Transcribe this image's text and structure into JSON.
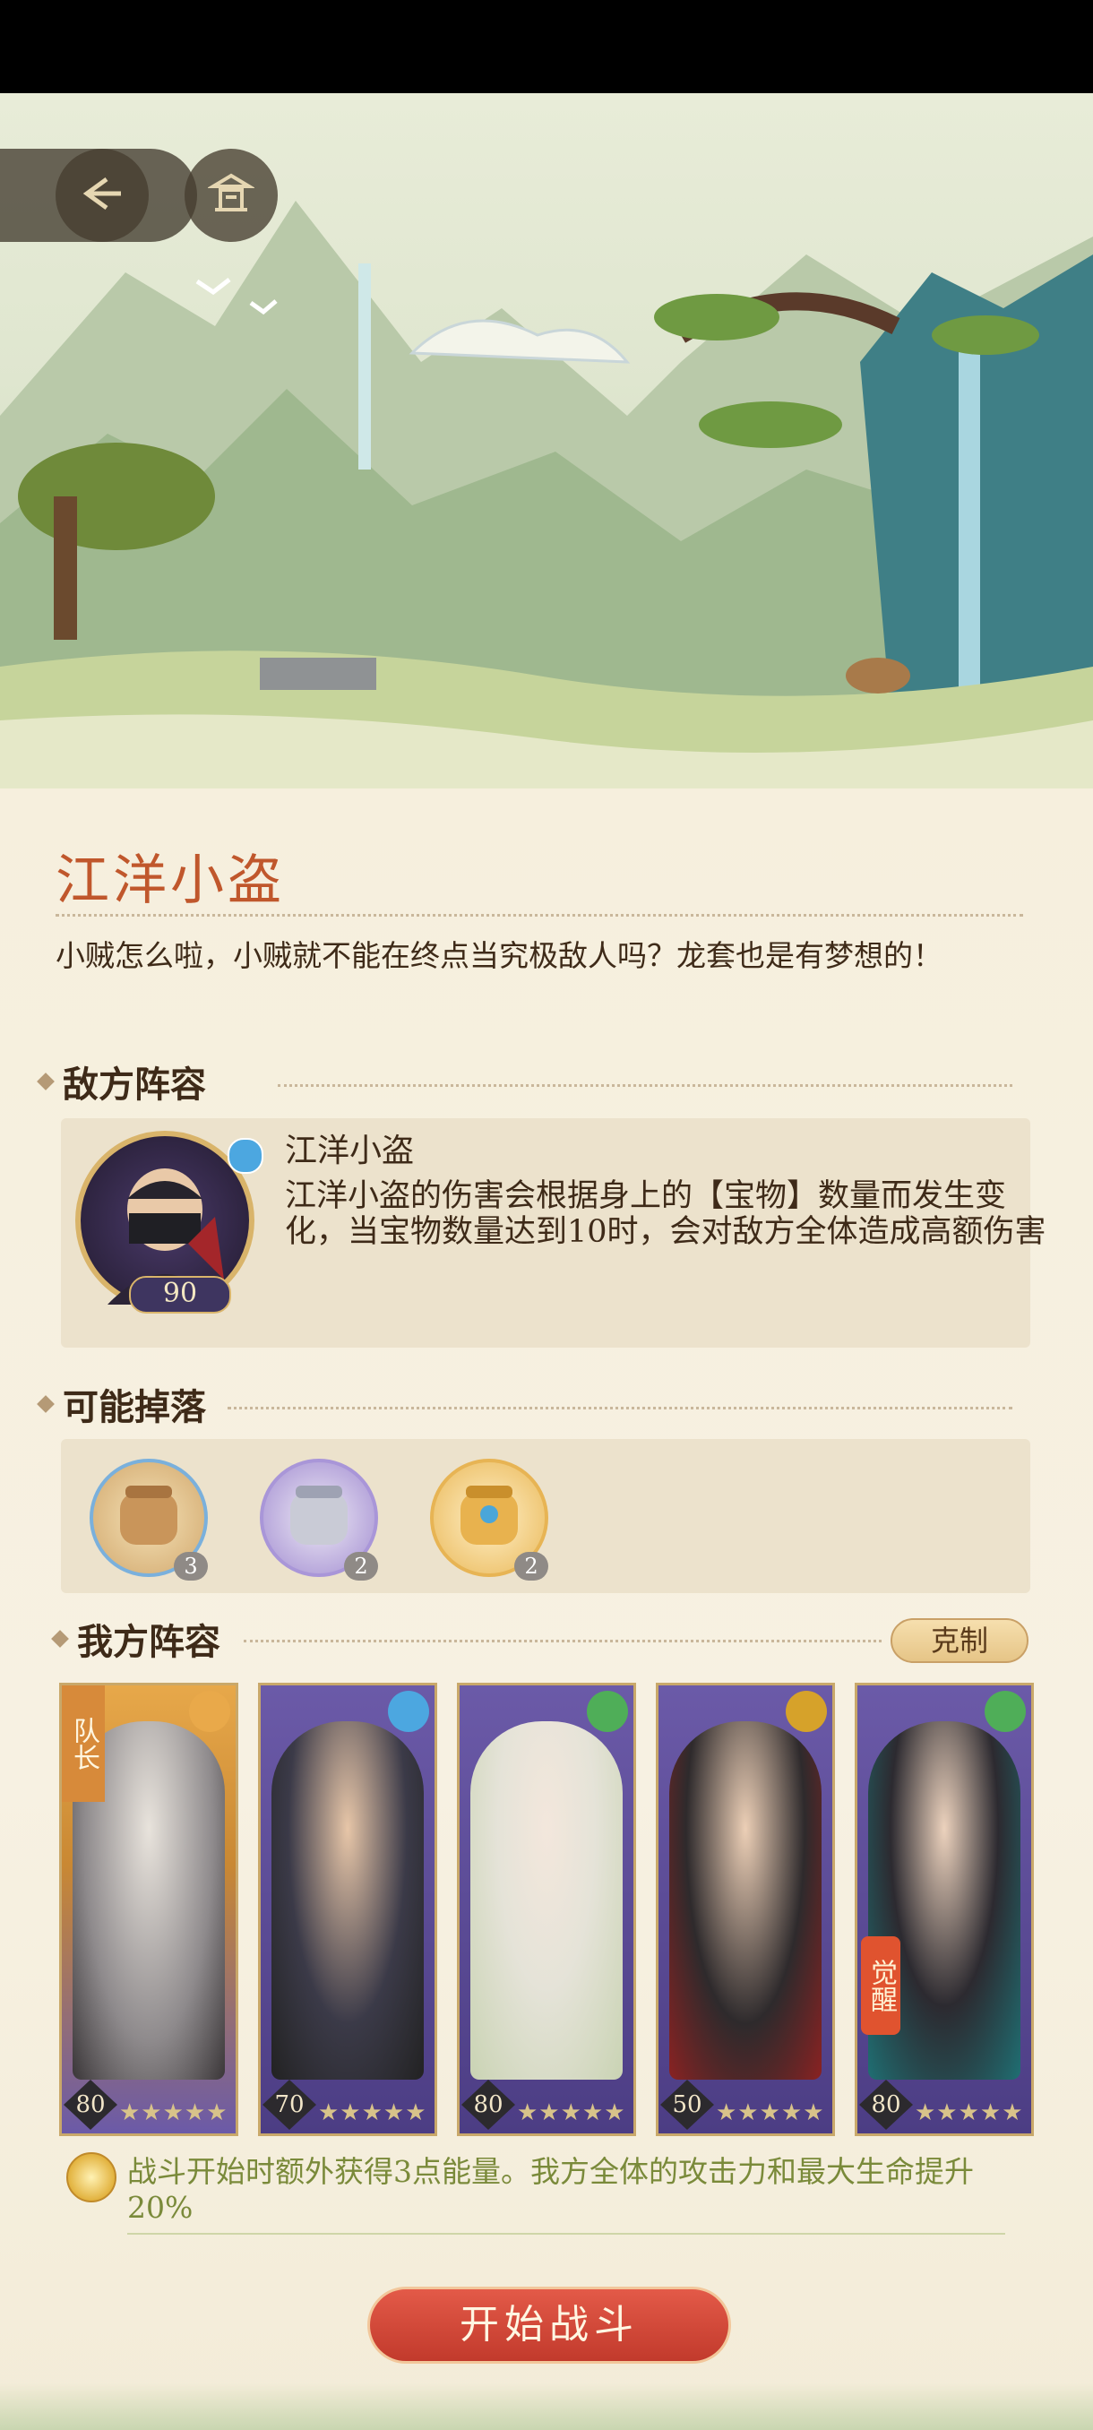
{
  "stage": {
    "title": "江洋小盗",
    "description": "小贼怎么啦，小贼就不能在终点当究极敌人吗？龙套也是有梦想的！"
  },
  "enemy_section": {
    "heading": "敌方阵容",
    "enemy": {
      "name": "江洋小盗",
      "level": "90",
      "element": "wave-icon",
      "ability": "江洋小盗的伤害会根据身上的【宝物】数量而发生变化，当宝物数量达到10时，会对敌方全体造成高额伤害"
    }
  },
  "drops_section": {
    "heading": "可能掉落",
    "items": [
      {
        "icon": "bronze-treasure-jar-icon",
        "count": "3",
        "color": "#e2c08a"
      },
      {
        "icon": "silver-treasure-jar-icon",
        "count": "2",
        "color": "#cfc9de"
      },
      {
        "icon": "gold-treasure-jar-icon",
        "count": "2",
        "color": "#f0c97a"
      }
    ]
  },
  "team_section": {
    "heading": "我方阵容",
    "counter_label": "克制",
    "leader_label": "队长",
    "awakened_label": "觉醒",
    "members": [
      {
        "level": "80",
        "stars": "★★★★★",
        "element": "moon-icon",
        "accent": "#e9a94a"
      },
      {
        "level": "70",
        "stars": "★★★★★",
        "element": "wave-icon",
        "accent": "#4ca7e0"
      },
      {
        "level": "80",
        "stars": "★★★★★",
        "element": "wind-icon",
        "accent": "#4fae58"
      },
      {
        "level": "50",
        "stars": "★★★★★",
        "element": "mountain-icon",
        "accent": "#d6a22a"
      },
      {
        "level": "80",
        "stars": "★★★★★",
        "element": "wind-icon",
        "accent": "#4fae58"
      }
    ],
    "leader_buff": "战斗开始时额外获得3点能量。我方全体的攻击力和最大生命提升20%"
  },
  "actions": {
    "start_battle": "开始战斗"
  }
}
